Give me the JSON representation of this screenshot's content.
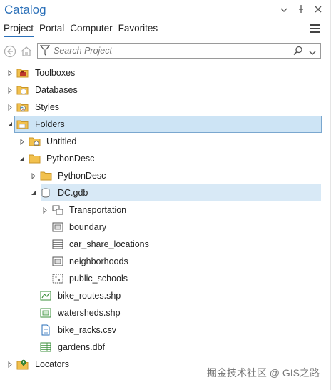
{
  "pane": {
    "title": "Catalog",
    "tabs": [
      "Project",
      "Portal",
      "Computer",
      "Favorites"
    ],
    "active_tab": "Project"
  },
  "search": {
    "placeholder": "Search Project"
  },
  "tree": {
    "toolboxes": "Toolboxes",
    "databases": "Databases",
    "styles": "Styles",
    "folders": "Folders",
    "untitled": "Untitled",
    "pythondesc": "PythonDesc",
    "pythondesc_sub": "PythonDesc",
    "dcgdb": "DC.gdb",
    "transportation": "Transportation",
    "boundary": "boundary",
    "car_share": "car_share_locations",
    "neighborhoods": "neighborhoods",
    "public_schools": "public_schools",
    "bike_routes": "bike_routes.shp",
    "watersheds": "watersheds.shp",
    "bike_racks": "bike_racks.csv",
    "gardens": "gardens.dbf",
    "locators": "Locators"
  },
  "watermark": "掘金技术社区 @ GIS之路"
}
